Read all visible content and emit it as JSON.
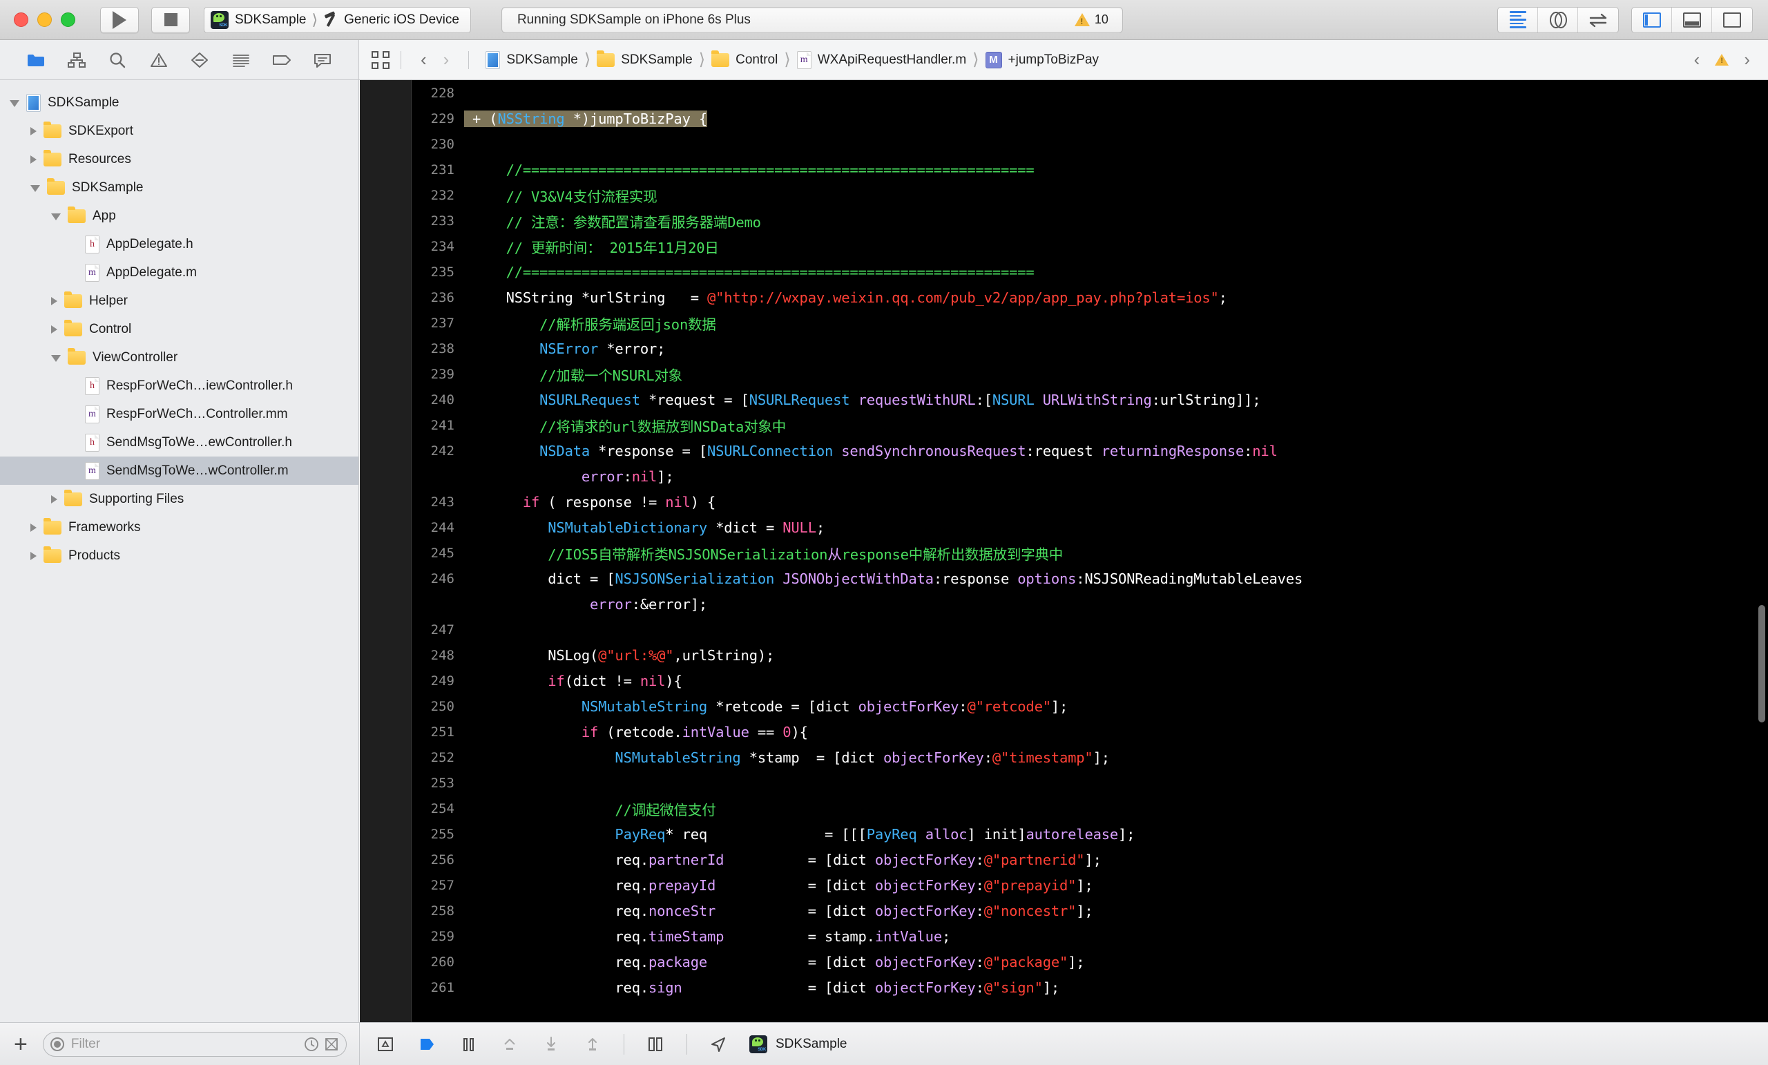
{
  "window": {
    "traffic_lights": [
      "close",
      "minimize",
      "zoom"
    ]
  },
  "toolbar": {
    "run_label": "Run",
    "stop_label": "Stop",
    "scheme_name": "SDKSample",
    "destination_name": "Generic iOS Device",
    "status_text": "Running SDKSample on iPhone 6s Plus",
    "warning_count": "10",
    "editor_modes": [
      "standard-editor",
      "assistant-editor",
      "version-editor"
    ],
    "view_toggles": [
      "navigator-panel",
      "debug-panel",
      "utilities-panel"
    ]
  },
  "navigator_bar": {
    "icons": [
      "project-navigator-icon",
      "symbol-navigator-icon",
      "find-navigator-icon",
      "issue-navigator-icon",
      "test-navigator-icon",
      "debug-navigator-icon",
      "breakpoint-navigator-icon",
      "report-navigator-icon"
    ]
  },
  "jump_bar": {
    "related_items_icon": "related-items-icon",
    "back_label": "‹",
    "forward_label": "›",
    "breadcrumbs": [
      {
        "label": "SDKSample",
        "icon": "project-icon"
      },
      {
        "label": "SDKSample",
        "icon": "folder-icon"
      },
      {
        "label": "Control",
        "icon": "folder-icon"
      },
      {
        "label": "WXApiRequestHandler.m",
        "icon": "m-file-icon"
      },
      {
        "label": "+jumpToBizPay",
        "icon": "method-icon"
      }
    ]
  },
  "sidebar": {
    "items": [
      {
        "label": "SDKSample",
        "indent": 0,
        "disclosure": "open",
        "icon": "project-icon",
        "selected": false
      },
      {
        "label": "SDKExport",
        "indent": 1,
        "disclosure": "closed",
        "icon": "folder-icon",
        "selected": false
      },
      {
        "label": "Resources",
        "indent": 1,
        "disclosure": "closed",
        "icon": "folder-icon",
        "selected": false
      },
      {
        "label": "SDKSample",
        "indent": 1,
        "disclosure": "open",
        "icon": "folder-icon",
        "selected": false
      },
      {
        "label": "App",
        "indent": 2,
        "disclosure": "open",
        "icon": "folder-icon",
        "selected": false
      },
      {
        "label": "AppDelegate.h",
        "indent": 3,
        "disclosure": "none",
        "icon": "h-file-icon",
        "selected": false
      },
      {
        "label": "AppDelegate.m",
        "indent": 3,
        "disclosure": "none",
        "icon": "m-file-icon",
        "selected": false
      },
      {
        "label": "Helper",
        "indent": 2,
        "disclosure": "closed",
        "icon": "folder-icon",
        "selected": false
      },
      {
        "label": "Control",
        "indent": 2,
        "disclosure": "closed",
        "icon": "folder-icon",
        "selected": false
      },
      {
        "label": "ViewController",
        "indent": 2,
        "disclosure": "open",
        "icon": "folder-icon",
        "selected": false
      },
      {
        "label": "RespForWeCh…iewController.h",
        "indent": 3,
        "disclosure": "none",
        "icon": "h-file-icon",
        "selected": false
      },
      {
        "label": "RespForWeCh…Controller.mm",
        "indent": 3,
        "disclosure": "none",
        "icon": "m-file-icon",
        "selected": false
      },
      {
        "label": "SendMsgToWe…ewController.h",
        "indent": 3,
        "disclosure": "none",
        "icon": "h-file-icon",
        "selected": false
      },
      {
        "label": "SendMsgToWe…wController.m",
        "indent": 3,
        "disclosure": "none",
        "icon": "m-file-icon",
        "selected": true
      },
      {
        "label": "Supporting Files",
        "indent": 2,
        "disclosure": "closed",
        "icon": "folder-icon",
        "selected": false
      },
      {
        "label": "Frameworks",
        "indent": 1,
        "disclosure": "closed",
        "icon": "folder-icon",
        "selected": false
      },
      {
        "label": "Products",
        "indent": 1,
        "disclosure": "closed",
        "icon": "folder-icon",
        "selected": false
      }
    ]
  },
  "editor": {
    "language": "objective-c",
    "first_line": 228,
    "highlighted_line": 229,
    "lines": [
      {
        "n": 228,
        "tokens": []
      },
      {
        "n": 229,
        "highlight": true,
        "tokens": [
          {
            "t": "+ (",
            "c": "pln"
          },
          {
            "t": "NSString",
            "c": "typ"
          },
          {
            "t": " *)jumpToBizPay {",
            "c": "pln"
          }
        ]
      },
      {
        "n": 230,
        "tokens": []
      },
      {
        "n": 231,
        "tokens": [
          {
            "t": "    //=============================================================",
            "c": "cmt"
          }
        ]
      },
      {
        "n": 232,
        "tokens": [
          {
            "t": "    // V3&V4支付流程实现",
            "c": "cmt"
          }
        ]
      },
      {
        "n": 233,
        "tokens": [
          {
            "t": "    // 注意：参数配置请查看服务器端Demo",
            "c": "cmt"
          }
        ]
      },
      {
        "n": 234,
        "tokens": [
          {
            "t": "    // 更新时间： 2015年11月20日",
            "c": "cmt"
          }
        ]
      },
      {
        "n": 235,
        "tokens": [
          {
            "t": "    //=============================================================",
            "c": "cmt"
          }
        ]
      },
      {
        "n": 236,
        "tokens": [
          {
            "t": "    NSString *urlString   = ",
            "c": "pln"
          },
          {
            "t": "@\"http://wxpay.weixin.qq.com/pub_v2/app/app_pay.php?plat=ios\"",
            "c": "str"
          },
          {
            "t": ";",
            "c": "pln"
          }
        ]
      },
      {
        "n": 237,
        "tokens": [
          {
            "t": "        //解析服务端返回json数据",
            "c": "cmt"
          }
        ]
      },
      {
        "n": 238,
        "tokens": [
          {
            "t": "        ",
            "c": "pln"
          },
          {
            "t": "NSError",
            "c": "typ"
          },
          {
            "t": " *error;",
            "c": "pln"
          }
        ]
      },
      {
        "n": 239,
        "tokens": [
          {
            "t": "        //加载一个NSURL对象",
            "c": "cmt"
          }
        ]
      },
      {
        "n": 240,
        "tokens": [
          {
            "t": "        ",
            "c": "pln"
          },
          {
            "t": "NSURLRequest",
            "c": "typ"
          },
          {
            "t": " *request = [",
            "c": "pln"
          },
          {
            "t": "NSURLRequest",
            "c": "typ"
          },
          {
            "t": " requestWithURL",
            "c": "sel"
          },
          {
            "t": ":[",
            "c": "pln"
          },
          {
            "t": "NSURL",
            "c": "typ"
          },
          {
            "t": " URLWithString",
            "c": "sel"
          },
          {
            "t": ":urlString]];",
            "c": "pln"
          }
        ]
      },
      {
        "n": 241,
        "tokens": [
          {
            "t": "        //将请求的url数据放到NSData对象中",
            "c": "cmt"
          }
        ]
      },
      {
        "n": 242,
        "tokens": [
          {
            "t": "        ",
            "c": "pln"
          },
          {
            "t": "NSData",
            "c": "typ"
          },
          {
            "t": " *response = [",
            "c": "pln"
          },
          {
            "t": "NSURLConnection",
            "c": "typ"
          },
          {
            "t": " sendSynchronousRequest",
            "c": "sel"
          },
          {
            "t": ":request ",
            "c": "pln"
          },
          {
            "t": "returningResponse",
            "c": "sel"
          },
          {
            "t": ":",
            "c": "pln"
          },
          {
            "t": "nil",
            "c": "kw"
          }
        ]
      },
      {
        "n": null,
        "cont": true,
        "tokens": [
          {
            "t": "             ",
            "c": "pln"
          },
          {
            "t": "error",
            "c": "sel"
          },
          {
            "t": ":",
            "c": "pln"
          },
          {
            "t": "nil",
            "c": "kw"
          },
          {
            "t": "];",
            "c": "pln"
          }
        ]
      },
      {
        "n": 243,
        "tokens": [
          {
            "t": "      ",
            "c": "pln"
          },
          {
            "t": "if",
            "c": "kw"
          },
          {
            "t": " ( response != ",
            "c": "pln"
          },
          {
            "t": "nil",
            "c": "kw"
          },
          {
            "t": ") {",
            "c": "pln"
          }
        ]
      },
      {
        "n": 244,
        "tokens": [
          {
            "t": "         ",
            "c": "pln"
          },
          {
            "t": "NSMutableDictionary",
            "c": "typ"
          },
          {
            "t": " *dict = ",
            "c": "pln"
          },
          {
            "t": "NULL",
            "c": "kw"
          },
          {
            "t": ";",
            "c": "pln"
          }
        ]
      },
      {
        "n": 245,
        "tokens": [
          {
            "t": "         //IOS5自带解析类NSJSONSerialization",
            "c": "cmt"
          },
          {
            "t": "从",
            "c": "sel"
          },
          {
            "t": "response中解析出数据放到字典中",
            "c": "cmt"
          }
        ]
      },
      {
        "n": 246,
        "tokens": [
          {
            "t": "         dict = [",
            "c": "pln"
          },
          {
            "t": "NSJSONSerialization",
            "c": "typ"
          },
          {
            "t": " JSONObjectWithData",
            "c": "sel"
          },
          {
            "t": ":response ",
            "c": "pln"
          },
          {
            "t": "options",
            "c": "sel"
          },
          {
            "t": ":NSJSONReadingMutableLeaves",
            "c": "pln"
          }
        ]
      },
      {
        "n": null,
        "cont": true,
        "tokens": [
          {
            "t": "              ",
            "c": "pln"
          },
          {
            "t": "error",
            "c": "sel"
          },
          {
            "t": ":&error];",
            "c": "pln"
          }
        ]
      },
      {
        "n": 247,
        "tokens": []
      },
      {
        "n": 248,
        "tokens": [
          {
            "t": "         NSLog(",
            "c": "pln"
          },
          {
            "t": "@\"url:%@\"",
            "c": "str"
          },
          {
            "t": ",urlString);",
            "c": "pln"
          }
        ]
      },
      {
        "n": 249,
        "tokens": [
          {
            "t": "         ",
            "c": "pln"
          },
          {
            "t": "if",
            "c": "kw"
          },
          {
            "t": "(dict != ",
            "c": "pln"
          },
          {
            "t": "nil",
            "c": "kw"
          },
          {
            "t": "){",
            "c": "pln"
          }
        ]
      },
      {
        "n": 250,
        "tokens": [
          {
            "t": "             ",
            "c": "pln"
          },
          {
            "t": "NSMutableString",
            "c": "typ"
          },
          {
            "t": " *retcode = [dict ",
            "c": "pln"
          },
          {
            "t": "objectForKey",
            "c": "sel"
          },
          {
            "t": ":",
            "c": "pln"
          },
          {
            "t": "@\"retcode\"",
            "c": "str"
          },
          {
            "t": "];",
            "c": "pln"
          }
        ]
      },
      {
        "n": 251,
        "tokens": [
          {
            "t": "             ",
            "c": "pln"
          },
          {
            "t": "if",
            "c": "kw"
          },
          {
            "t": " (retcode.",
            "c": "pln"
          },
          {
            "t": "intValue",
            "c": "sel"
          },
          {
            "t": " == ",
            "c": "pln"
          },
          {
            "t": "0",
            "c": "kw"
          },
          {
            "t": "){",
            "c": "pln"
          }
        ]
      },
      {
        "n": 252,
        "tokens": [
          {
            "t": "                 ",
            "c": "pln"
          },
          {
            "t": "NSMutableString",
            "c": "typ"
          },
          {
            "t": " *stamp  = [dict ",
            "c": "pln"
          },
          {
            "t": "objectForKey",
            "c": "sel"
          },
          {
            "t": ":",
            "c": "pln"
          },
          {
            "t": "@\"timestamp\"",
            "c": "str"
          },
          {
            "t": "];",
            "c": "pln"
          }
        ]
      },
      {
        "n": 253,
        "tokens": []
      },
      {
        "n": 254,
        "tokens": [
          {
            "t": "                 //调起微信支付",
            "c": "cmt"
          }
        ]
      },
      {
        "n": 255,
        "tokens": [
          {
            "t": "                 ",
            "c": "pln"
          },
          {
            "t": "PayReq",
            "c": "typ"
          },
          {
            "t": "* req              = [[[",
            "c": "pln"
          },
          {
            "t": "PayReq",
            "c": "typ"
          },
          {
            "t": " alloc",
            "c": "sel"
          },
          {
            "t": "] ",
            "c": "pln"
          },
          {
            "t": "init",
            "c": "pln"
          },
          {
            "t": "]",
            "c": "pln"
          },
          {
            "t": "autorelease",
            "c": "sel"
          },
          {
            "t": "];",
            "c": "pln"
          }
        ]
      },
      {
        "n": 256,
        "tokens": [
          {
            "t": "                 req.",
            "c": "pln"
          },
          {
            "t": "partnerId",
            "c": "sel"
          },
          {
            "t": "          = [dict ",
            "c": "pln"
          },
          {
            "t": "objectForKey",
            "c": "sel"
          },
          {
            "t": ":",
            "c": "pln"
          },
          {
            "t": "@\"partnerid\"",
            "c": "str"
          },
          {
            "t": "];",
            "c": "pln"
          }
        ]
      },
      {
        "n": 257,
        "tokens": [
          {
            "t": "                 req.",
            "c": "pln"
          },
          {
            "t": "prepayId",
            "c": "sel"
          },
          {
            "t": "           = [dict ",
            "c": "pln"
          },
          {
            "t": "objectForKey",
            "c": "sel"
          },
          {
            "t": ":",
            "c": "pln"
          },
          {
            "t": "@\"prepayid\"",
            "c": "str"
          },
          {
            "t": "];",
            "c": "pln"
          }
        ]
      },
      {
        "n": 258,
        "tokens": [
          {
            "t": "                 req.",
            "c": "pln"
          },
          {
            "t": "nonceStr",
            "c": "sel"
          },
          {
            "t": "           = [dict ",
            "c": "pln"
          },
          {
            "t": "objectForKey",
            "c": "sel"
          },
          {
            "t": ":",
            "c": "pln"
          },
          {
            "t": "@\"noncestr\"",
            "c": "str"
          },
          {
            "t": "];",
            "c": "pln"
          }
        ]
      },
      {
        "n": 259,
        "tokens": [
          {
            "t": "                 req.",
            "c": "pln"
          },
          {
            "t": "timeStamp",
            "c": "sel"
          },
          {
            "t": "          = stamp.",
            "c": "pln"
          },
          {
            "t": "intValue",
            "c": "sel"
          },
          {
            "t": ";",
            "c": "pln"
          }
        ]
      },
      {
        "n": 260,
        "tokens": [
          {
            "t": "                 req.",
            "c": "pln"
          },
          {
            "t": "package",
            "c": "sel"
          },
          {
            "t": "            = [dict ",
            "c": "pln"
          },
          {
            "t": "objectForKey",
            "c": "sel"
          },
          {
            "t": ":",
            "c": "pln"
          },
          {
            "t": "@\"package\"",
            "c": "str"
          },
          {
            "t": "];",
            "c": "pln"
          }
        ]
      },
      {
        "n": 261,
        "tokens": [
          {
            "t": "                 req.",
            "c": "pln"
          },
          {
            "t": "sign",
            "c": "sel"
          },
          {
            "t": "               = [dict ",
            "c": "pln"
          },
          {
            "t": "objectForKey",
            "c": "sel"
          },
          {
            "t": ":",
            "c": "pln"
          },
          {
            "t": "@\"sign\"",
            "c": "str"
          },
          {
            "t": "];",
            "c": "pln"
          }
        ]
      }
    ]
  },
  "bottom_bar": {
    "add_label": "+",
    "filter_placeholder": "Filter",
    "debug_icons": [
      "show-debug-area-icon",
      "step-over-icon",
      "pause-icon",
      "step-into-icon",
      "step-down-icon",
      "step-up-icon",
      "simulate-location-icon",
      "view-hierarchy-icon"
    ],
    "process_name": "SDKSample"
  },
  "colors": {
    "accent": "#2f7fe5",
    "warning": "#f5bb41",
    "selection": "#c3c8d0",
    "editor_bg": "#000000",
    "highlight_line": "#7d7458",
    "comment": "#4ade5f",
    "type": "#41b0f4",
    "keyword": "#ff5fa2",
    "string": "#ff4136",
    "selector": "#d9a0ff"
  }
}
